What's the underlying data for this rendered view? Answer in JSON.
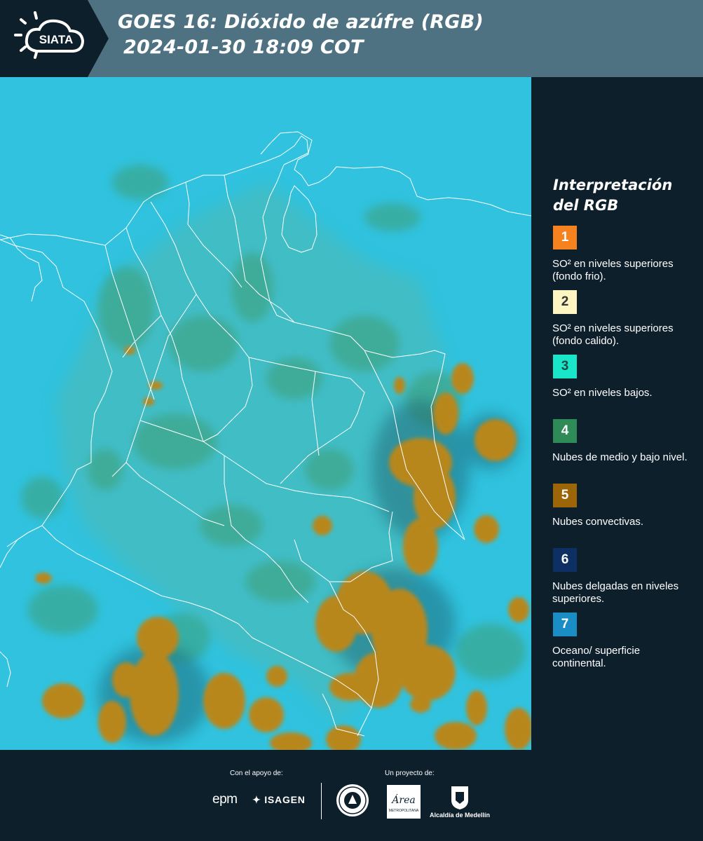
{
  "header": {
    "logo_text": "SIATA",
    "title_line1": "GOES 16: Dióxido de azúfre (RGB)",
    "title_line2": "2024-01-30 18:09 COT"
  },
  "legend": {
    "title_line1": "Interpretación",
    "title_line2": "del RGB",
    "items": [
      {
        "number": "1",
        "color": "#f5821f",
        "text_color": "#ffffff",
        "label": "SO² en niveles superiores (fondo frio)."
      },
      {
        "number": "2",
        "color": "#fdf6c3",
        "text_color": "#333333",
        "label": "SO² en niveles superiores (fondo calido)."
      },
      {
        "number": "3",
        "color": "#19e6c8",
        "text_color": "#1d4a45",
        "label": "SO² en niveles bajos."
      },
      {
        "number": "4",
        "color": "#2e8b57",
        "text_color": "#ffffff",
        "label": "Nubes de medio y bajo nivel."
      },
      {
        "number": "5",
        "color": "#9c6508",
        "text_color": "#ffffff",
        "label": "Nubes convectivas."
      },
      {
        "number": "6",
        "color": "#0d2f63",
        "text_color": "#ffffff",
        "label": "Nubes delgadas en niveles superiores."
      },
      {
        "number": "7",
        "color": "#1a8ec4",
        "text_color": "#ffffff",
        "label": "Oceano/ superficie continental."
      }
    ]
  },
  "map": {
    "ocean_color": "#2ec0dc",
    "vegetation_color": "#3aa97a",
    "convective_color": "#b7861c",
    "border_color": "#ffffff"
  },
  "footer": {
    "support_label": "Con el apoyo de:",
    "project_label": "Un proyecto de:",
    "sponsor_1": "epm",
    "sponsor_2": "ISAGEN",
    "partner_area_text": "Área",
    "partner_area_sub": "METROPOLITANA",
    "partner_alcaldia": "Alcaldía de Medellín"
  }
}
